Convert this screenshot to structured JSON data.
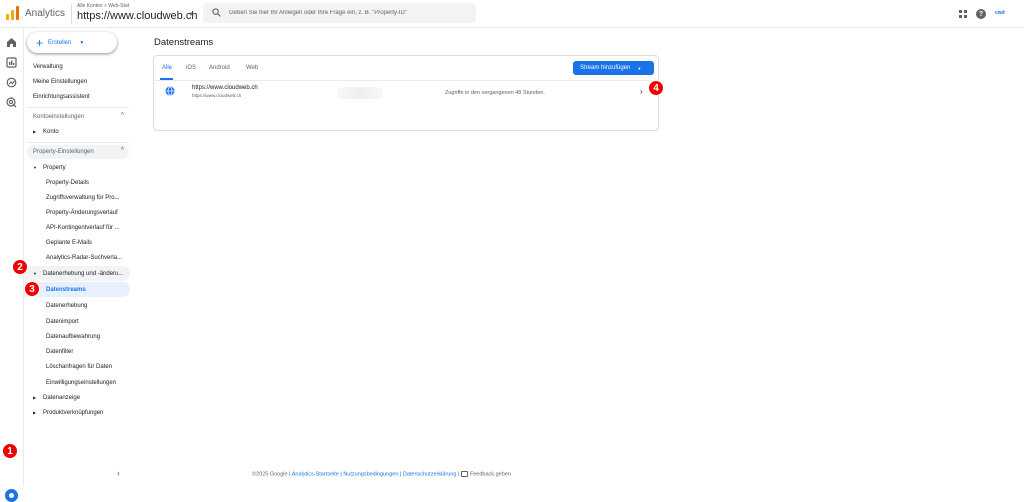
{
  "topbar": {
    "brand": "Analytics",
    "account_path": "Alle Konten > Web-Stat",
    "property": "https://www.cloudweb.ch",
    "search_placeholder": "Geben Sie hier Ihr Anliegen oder Ihre Frage ein, z. B. \"Property-ID\"",
    "avatar_text": "cwd",
    "icons": [
      "apps-grid-icon",
      "help-icon"
    ]
  },
  "colors": {
    "accent": "#1a73e8",
    "badge": "#e00000",
    "active_bg": "#e8f0fe"
  },
  "sidebar": {
    "create_label": "Erstellen",
    "top_items": [
      "Verwaltung",
      "Meine Einstellungen",
      "Einrichtungsassistent"
    ],
    "account_section": {
      "title": "Kontoeinstellungen",
      "items": [
        "Konto"
      ]
    },
    "property_section": {
      "title": "Property-Einstellungen",
      "property_label": "Property",
      "property_items": [
        "Property-Details",
        "Zugriffsverwaltung für Pro...",
        "Property-Änderungsverlauf",
        "API-Kontingentverlauf für ...",
        "Geplante E-Mails",
        "Analytics-Radar-Suchverla..."
      ],
      "data_collection_label": "Datenerhebung und -änderu...",
      "data_collection_items": [
        "Datenstreams",
        "Datenerhebung",
        "Datenimport",
        "Datenaufbewahrung",
        "Datenfilter",
        "Löschanfragen für Daten",
        "Einwilligungseinstellungen"
      ],
      "more": [
        "Datenanzeige",
        "Produktverknüpfungen"
      ]
    }
  },
  "main": {
    "title": "Datenstreams",
    "tabs": [
      "Alle",
      "iOS",
      "Android",
      "Web"
    ],
    "add_stream_label": "Stream hinzufügen",
    "streams": [
      {
        "name": "https://www.cloudweb.ch",
        "url": "https://www.cloudweb.ch",
        "status": "Zugriffe in den vergangenen 48 Stunden."
      }
    ]
  },
  "badges": [
    "1",
    "2",
    "3",
    "4"
  ],
  "footer": {
    "copyright": "©2025 Google |",
    "links": [
      "Analytics-Startseite",
      "Nutzungsbedingungen",
      "Datenschutzerklärung"
    ],
    "feedback": "Feedback geben"
  }
}
